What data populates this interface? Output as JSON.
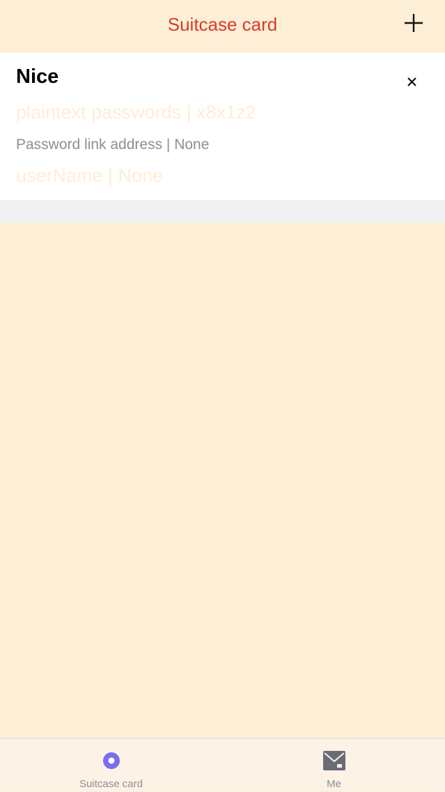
{
  "nav": {
    "title": "Suitcase card",
    "add_icon": "plus-icon"
  },
  "card": {
    "title": "Nice",
    "close_icon": "close-icon",
    "password_line": "plaintext passwords | x8x1z2",
    "link_line": "Password link address | None",
    "username_line": "userName | None"
  },
  "tabs": [
    {
      "label": "Suitcase card",
      "icon": "record-circle-icon",
      "color": "#7b6cf0"
    },
    {
      "label": "Me",
      "icon": "mail-icon",
      "color": "#6b6b78"
    }
  ],
  "colors": {
    "background": "#fdeed6",
    "title_red": "#d93a2b",
    "card_bg": "#ffffff",
    "secondary_text": "#8e8e93"
  }
}
